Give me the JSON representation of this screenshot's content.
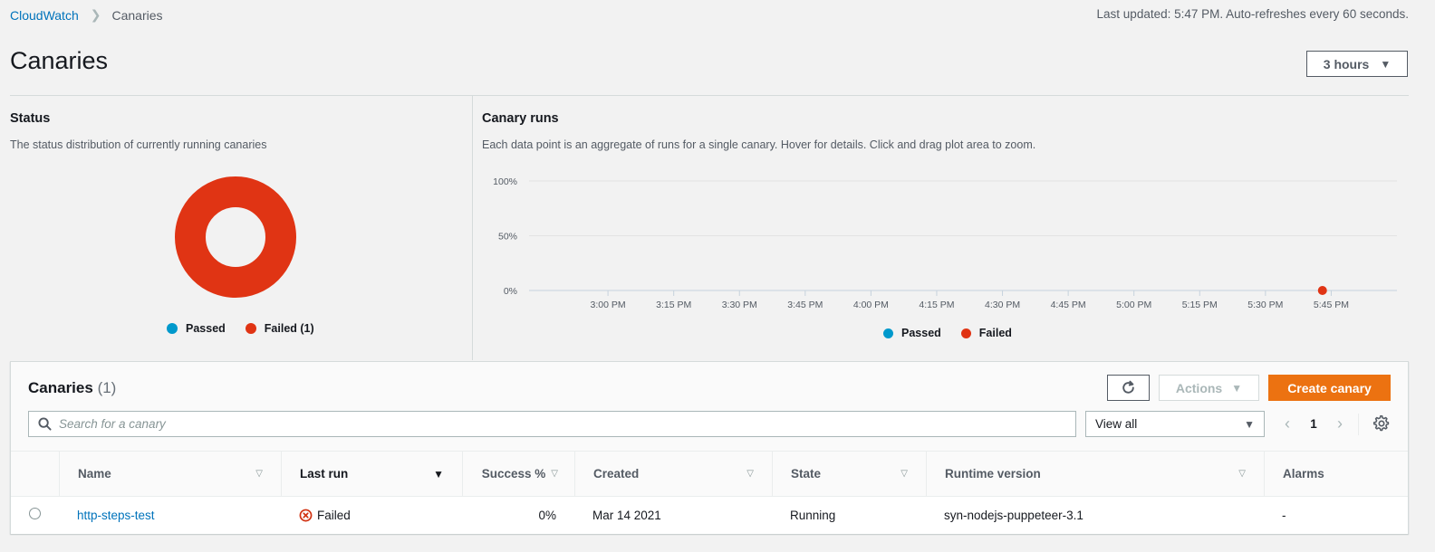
{
  "breadcrumb": {
    "items": [
      {
        "label": "CloudWatch",
        "link": true
      },
      {
        "label": "Canaries",
        "link": false
      }
    ],
    "separator_icon": "chevron-right-icon"
  },
  "last_updated": "Last updated: 5:47 PM. Auto-refreshes every 60 seconds.",
  "page_title": "Canaries",
  "time_range": {
    "selected": "3 hours",
    "icon": "caret-down-icon"
  },
  "status_panel": {
    "title": "Status",
    "description": "The status distribution of currently running canaries",
    "legend": [
      {
        "label": "Passed",
        "color": "#0099cc"
      },
      {
        "label": "Failed (1)",
        "color": "#e03414"
      }
    ]
  },
  "runs_panel": {
    "title": "Canary runs",
    "description": "Each data point is an aggregate of runs for a single canary. Hover for details. Click and drag plot area to zoom.",
    "legend": [
      {
        "label": "Passed",
        "color": "#0099cc"
      },
      {
        "label": "Failed",
        "color": "#e03414"
      }
    ]
  },
  "chart_data": [
    {
      "type": "pie",
      "title": "Status",
      "donut": true,
      "categories": [
        "Passed",
        "Failed"
      ],
      "values": [
        0,
        1
      ],
      "colors": [
        "#0099cc",
        "#e03414"
      ],
      "legend": "bottom"
    },
    {
      "type": "scatter",
      "title": "Canary runs",
      "xlabel": "",
      "ylabel": "",
      "x_ticks": [
        "3:00 PM",
        "3:15 PM",
        "3:30 PM",
        "3:45 PM",
        "4:00 PM",
        "4:15 PM",
        "4:30 PM",
        "4:45 PM",
        "5:00 PM",
        "5:15 PM",
        "5:30 PM",
        "5:45 PM"
      ],
      "x_range_minutes": [
        -18,
        180
      ],
      "y_ticks": [
        "0%",
        "50%",
        "100%"
      ],
      "ylim": [
        0,
        100
      ],
      "grid": true,
      "legend": "bottom",
      "series": [
        {
          "name": "Passed",
          "color": "#0099cc",
          "points": []
        },
        {
          "name": "Failed",
          "color": "#e03414",
          "points": [
            {
              "x": "5:43 PM",
              "x_minutes": 163,
              "y": 0
            }
          ]
        }
      ]
    }
  ],
  "canaries": {
    "title": "Canaries",
    "count": "(1)",
    "refresh_icon": "refresh-icon",
    "actions_label": "Actions",
    "create_label": "Create canary",
    "search_placeholder": "Search for a canary",
    "search_value": "",
    "filter_selected": "View all",
    "page": "1",
    "columns": [
      {
        "label": "Name",
        "sortable": true,
        "sorted": false
      },
      {
        "label": "Last run",
        "sortable": true,
        "sorted": true
      },
      {
        "label": "Success %",
        "sortable": true,
        "sorted": false
      },
      {
        "label": "Created",
        "sortable": true,
        "sorted": false
      },
      {
        "label": "State",
        "sortable": true,
        "sorted": false
      },
      {
        "label": "Runtime version",
        "sortable": true,
        "sorted": false
      },
      {
        "label": "Alarms",
        "sortable": false,
        "sorted": false
      }
    ],
    "rows": [
      {
        "name": "http-steps-test",
        "last_run": "Failed",
        "last_run_icon": "error-circle-icon",
        "success": "0%",
        "created": "Mar 14 2021",
        "state": "Running",
        "runtime": "syn-nodejs-puppeteer-3.1",
        "alarms": "-"
      }
    ]
  }
}
